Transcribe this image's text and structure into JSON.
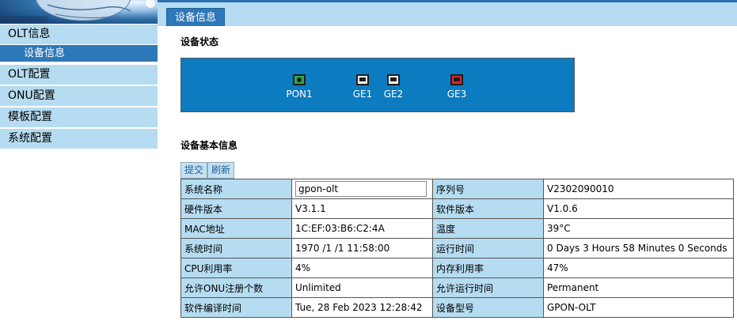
{
  "colors": {
    "accent": "#2d78b8",
    "menu_bg": "#b6dcf1",
    "panel_bg": "#0c7bc0",
    "port_fault": "#d62b2b",
    "port_pon": "#2fa84a"
  },
  "sidebar": {
    "items": [
      {
        "label": "OLT信息",
        "active": false
      },
      {
        "label": "设备信息",
        "active": true,
        "sub": true
      },
      {
        "label": "OLT配置",
        "active": false
      },
      {
        "label": "ONU配置",
        "active": false
      },
      {
        "label": "模板配置",
        "active": false
      },
      {
        "label": "系统配置",
        "active": false
      }
    ]
  },
  "tabs": [
    {
      "label": "设备信息"
    }
  ],
  "status": {
    "title": "设备状态",
    "ports": [
      {
        "label": "PON1",
        "icon": "pon-port-icon",
        "state": "up"
      },
      {
        "label": "GE1",
        "icon": "ethernet-port-icon",
        "state": "normal"
      },
      {
        "label": "GE2",
        "icon": "ethernet-port-icon",
        "state": "normal"
      },
      {
        "label": "GE3",
        "icon": "ethernet-port-icon",
        "state": "fault"
      }
    ]
  },
  "basic": {
    "title": "设备基本信息",
    "submit_label": "提交",
    "refresh_label": "刷新",
    "rows": [
      {
        "l1": "系统名称",
        "v1": "gpon-olt",
        "l2": "序列号",
        "v2": "V2302090010"
      },
      {
        "l1": "硬件版本",
        "v1": "V3.1.1",
        "l2": "软件版本",
        "v2": "V1.0.6"
      },
      {
        "l1": "MAC地址",
        "v1": "1C:EF:03:B6:C2:4A",
        "l2": "温度",
        "v2": "39°C"
      },
      {
        "l1": "系统时间",
        "v1": "1970 /1 /1 11:58:00",
        "l2": "运行时间",
        "v2": "0 Days 3 Hours 58 Minutes 0 Seconds"
      },
      {
        "l1": "CPU利用率",
        "v1": "4%",
        "l2": "内存利用率",
        "v2": "47%"
      },
      {
        "l1": "允许ONU注册个数",
        "v1": "Unlimited",
        "l2": "允许运行时间",
        "v2": "Permanent"
      },
      {
        "l1": "软件编译时间",
        "v1": "Tue, 28 Feb 2023 12:28:42",
        "l2": "设备型号",
        "v2": "GPON-OLT"
      }
    ]
  }
}
